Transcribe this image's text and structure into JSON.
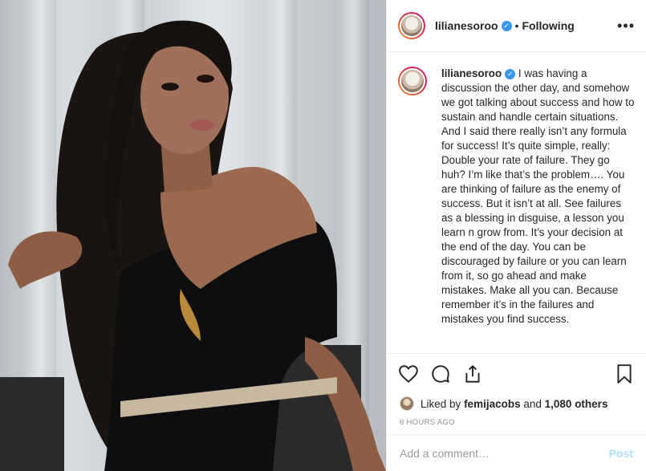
{
  "header": {
    "username": "lilianesoroo",
    "separator": "•",
    "follow_status": "Following",
    "more_label": "•••"
  },
  "caption": {
    "username": "lilianesoroo",
    "text": "I was having a discussion the other day, and somehow we got talking about success and how to sustain and handle certain situations. And I said there really isn’t any formula for success! It’s quite simple, really: Double your rate of failure. They go huh? I’m like that’s the problem…. You are thinking of failure as the enemy of success. But it isn’t at all. See failures as a blessing in disguise, a lesson you learn n grow from. It’s your decision at the end of the day. You can be discouraged by failure or you can learn from it, so go ahead and make mistakes. Make all you can. Because remember it’s in the failures and mistakes you find success."
  },
  "actions": {
    "icons": [
      "heart-icon",
      "comment-icon",
      "share-icon",
      "bookmark-icon"
    ]
  },
  "likes": {
    "prefix": "Liked by",
    "user": "femijacobs",
    "joiner": "and",
    "others": "1,080 others"
  },
  "timestamp": "6 HOURS AGO",
  "comment_box": {
    "placeholder": "Add a comment…",
    "post_label": "Post"
  },
  "colors": {
    "verified_badge": "#3897f0",
    "post_button": "#b2dffc",
    "timestamp": "#8e8e8e"
  }
}
